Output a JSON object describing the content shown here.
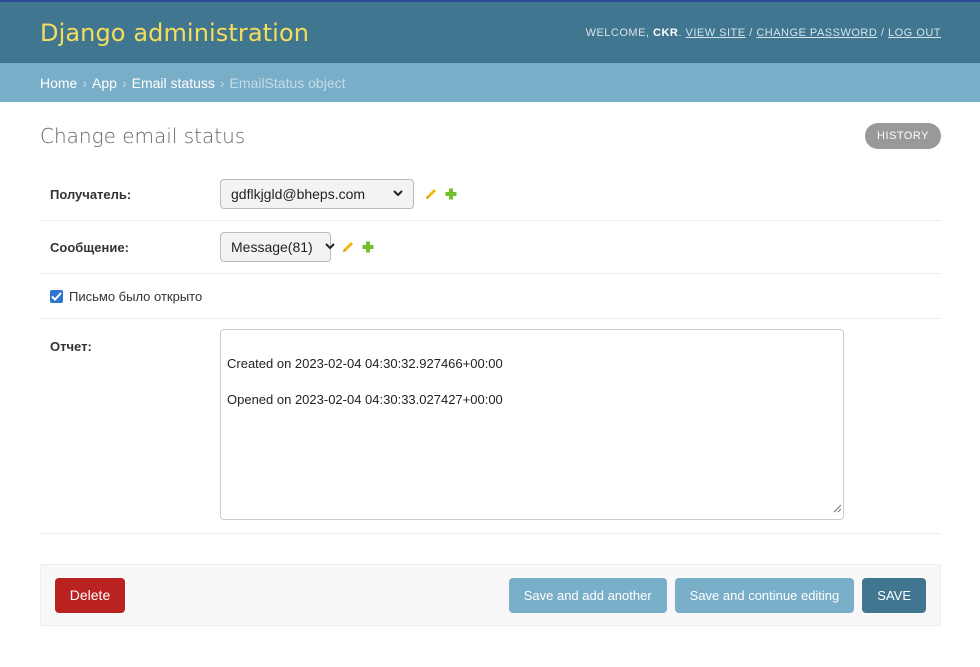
{
  "header": {
    "branding": "Django administration",
    "welcome": "Welcome,",
    "username": "CKR",
    "view_site": "View site",
    "change_password": "Change password",
    "log_out": "Log out",
    "separator": "/"
  },
  "breadcrumbs": {
    "home": "Home",
    "app": "App",
    "model": "Email statuss",
    "current": "EmailStatus object",
    "separator": "›"
  },
  "page": {
    "title": "Change email status",
    "history": "History"
  },
  "form": {
    "recipient_label": "Получатель:",
    "recipient_value": "gdflkjgld@bheps.com",
    "message_label": "Сообщение:",
    "message_value": "Message(81)",
    "opened_label": "Письмо было открыто",
    "opened_checked": true,
    "report_label": "Отчет:",
    "report_lines": [
      "Created on 2023-02-04 04:30:32.927466+00:00",
      "Opened on 2023-02-04 04:30:33.027427+00:00"
    ]
  },
  "actions": {
    "delete": "Delete",
    "save_add_another": "Save and add another",
    "save_continue": "Save and continue editing",
    "save": "Save"
  },
  "colors": {
    "header_bg": "#417690",
    "branding": "#f5dd5d",
    "breadcrumb_bg": "#79aec8",
    "delete": "#ba2121",
    "secondary_button": "#79aec8",
    "save_button": "#417690"
  },
  "icons": {
    "change": "pencil-icon",
    "add": "plus-icon",
    "checkbox": "checkmark-icon",
    "select": "chevron-down-icon",
    "resize": "resize-handle-icon"
  }
}
